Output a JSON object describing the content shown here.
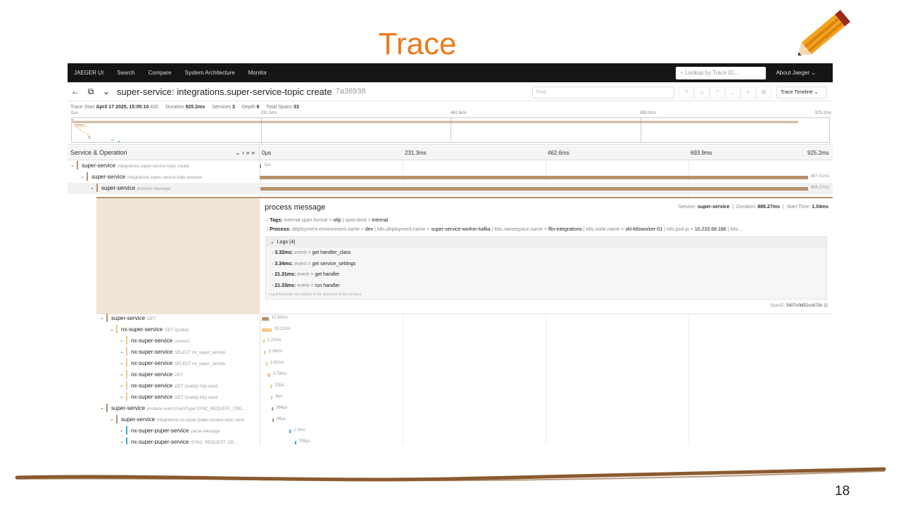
{
  "slide": {
    "title": "Trace",
    "page_number": "18"
  },
  "nav": {
    "brand": "JAEGER UI",
    "items": [
      "Search",
      "Compare",
      "System Architecture",
      "Monitor"
    ],
    "lookup_placeholder": "Lookup by Trace ID...",
    "about": "About Jaeger"
  },
  "trace": {
    "title": "super-service: integrations.super-service-topic create",
    "id": "7a36938",
    "find_placeholder": "Find...",
    "view_select": "Trace Timeline",
    "start_label": "Trace Start",
    "start_value": "April 17 2025, 15:05:10",
    "start_ms": ".435",
    "duration_label": "Duration",
    "duration_value": "925.2ms",
    "services_label": "Services",
    "services_value": "3",
    "depth_label": "Depth",
    "depth_value": "6",
    "spans_label": "Total Spans",
    "spans_value": "33"
  },
  "ticks": [
    "0μs",
    "231.3ms",
    "462.6ms",
    "693.9ms",
    "925.2ms"
  ],
  "column_header": "Service & Operation",
  "rows": [
    {
      "svc": "super-service",
      "op": "integrations.super-service-topic create",
      "dur": "3μs",
      "depth": 0,
      "color": "#b7916c",
      "start": 0.0,
      "len": 0.0005
    },
    {
      "svc": "super-service",
      "op": "integrations.super-service-topic process",
      "dur": "887.41ms",
      "depth": 1,
      "color": "#b7916c",
      "start": 0.0,
      "len": 0.959
    },
    {
      "svc": "super-service",
      "op": "process message",
      "dur": "886.27ms",
      "depth": 2,
      "color": "#b7916c",
      "start": 0.001,
      "len": 0.958,
      "selected": true
    },
    {
      "svc": "super-service",
      "op": "GET",
      "dur": "10.83ms",
      "depth": 3,
      "color": "#b7916c",
      "start": 0.004,
      "len": 0.0117
    },
    {
      "svc": "nx-super-service",
      "op": "GET /{code}/",
      "dur": "15.22ms",
      "depth": 4,
      "color": "#f0c98a",
      "start": 0.004,
      "len": 0.0165
    },
    {
      "svc": "nx-super-service",
      "op": "connect",
      "dur": "1.21ms",
      "depth": 5,
      "color": "#f0c98a",
      "start": 0.006,
      "len": 0.0013
    },
    {
      "svc": "nx-super-service",
      "op": "SELECT nx_super_service",
      "dur": "2.16ms",
      "depth": 5,
      "color": "#f0c98a",
      "start": 0.008,
      "len": 0.0023
    },
    {
      "svc": "nx-super-service",
      "op": "SELECT nx_super_service",
      "dur": "1.62ms",
      "depth": 5,
      "color": "#f0c98a",
      "start": 0.011,
      "len": 0.0018
    },
    {
      "svc": "nx-super-service",
      "op": "GET",
      "dur": "3.78ms",
      "depth": 5,
      "color": "#f0c98a",
      "start": 0.014,
      "len": 0.004
    },
    {
      "svc": "nx-super-service",
      "op": "GET /{code}/ http send",
      "dur": "22μs",
      "depth": 5,
      "color": "#f0c98a",
      "start": 0.019,
      "len": 0.0005
    },
    {
      "svc": "nx-super-service",
      "op": "GET /{code}/ http send",
      "dur": "9μs",
      "depth": 5,
      "color": "#f0c98a",
      "start": 0.02,
      "len": 0.0005
    },
    {
      "svc": "super-service",
      "op": "produce event.EventType.SYNC_REQUEST_CRE...",
      "dur": "384μs",
      "depth": 3,
      "color": "#b7916c",
      "start": 0.021,
      "len": 0.0005
    },
    {
      "svc": "super-service",
      "op": "integrations.nx-super-puper-service-topic send",
      "dur": "46μs",
      "depth": 4,
      "color": "#b7916c",
      "start": 0.022,
      "len": 0.0005
    },
    {
      "svc": "nx-super-puper-service",
      "op": "parse message",
      "dur": "1.3ms",
      "depth": 5,
      "color": "#3aa6d6",
      "start": 0.052,
      "len": 0.0014
    },
    {
      "svc": "nx-super-puper-service",
      "op": "SYNC_REQUEST_CR...",
      "dur": "799μs",
      "depth": 5,
      "color": "#3aa6d6",
      "start": 0.061,
      "len": 0.0009
    }
  ],
  "detail": {
    "title": "process message",
    "service_label": "Service:",
    "service": "super-service",
    "duration_label": "Duration:",
    "duration": "886.27ms",
    "start_label": "Start Time:",
    "start": "1.04ms",
    "tags_label": "Tags:",
    "tags": [
      {
        "k": "internal.span.format",
        "v": "otlp"
      },
      {
        "k": "span.kind",
        "v": "internal"
      }
    ],
    "process_label": "Process:",
    "process": [
      {
        "k": "deployment.environment.name",
        "v": "dev"
      },
      {
        "k": "k8s.deployment.name",
        "v": "super-service-worker-kafka"
      },
      {
        "k": "k8s.namespace.name",
        "v": "ffin-integrations"
      },
      {
        "k": "k8s.node.name",
        "v": "vkl-k8sworker-01"
      },
      {
        "k": "k8s.pod.ip",
        "v": "10.233.68.186"
      },
      {
        "k": "k8s...",
        "v": ""
      }
    ],
    "logs_label": "Logs (4)",
    "logs": [
      {
        "t": "3.32ms:",
        "k": "event",
        "v": "get handler_class"
      },
      {
        "t": "3.34ms:",
        "k": "event",
        "v": "get service_settings"
      },
      {
        "t": "21.31ms:",
        "k": "event",
        "v": "get handler"
      },
      {
        "t": "21.33ms:",
        "k": "event",
        "v": "run handler"
      }
    ],
    "log_note": "Log timestamps are relative to the start time of the full trace.",
    "span_id_label": "SpanID:",
    "span_id": "5407c0bf52ccb72b"
  }
}
